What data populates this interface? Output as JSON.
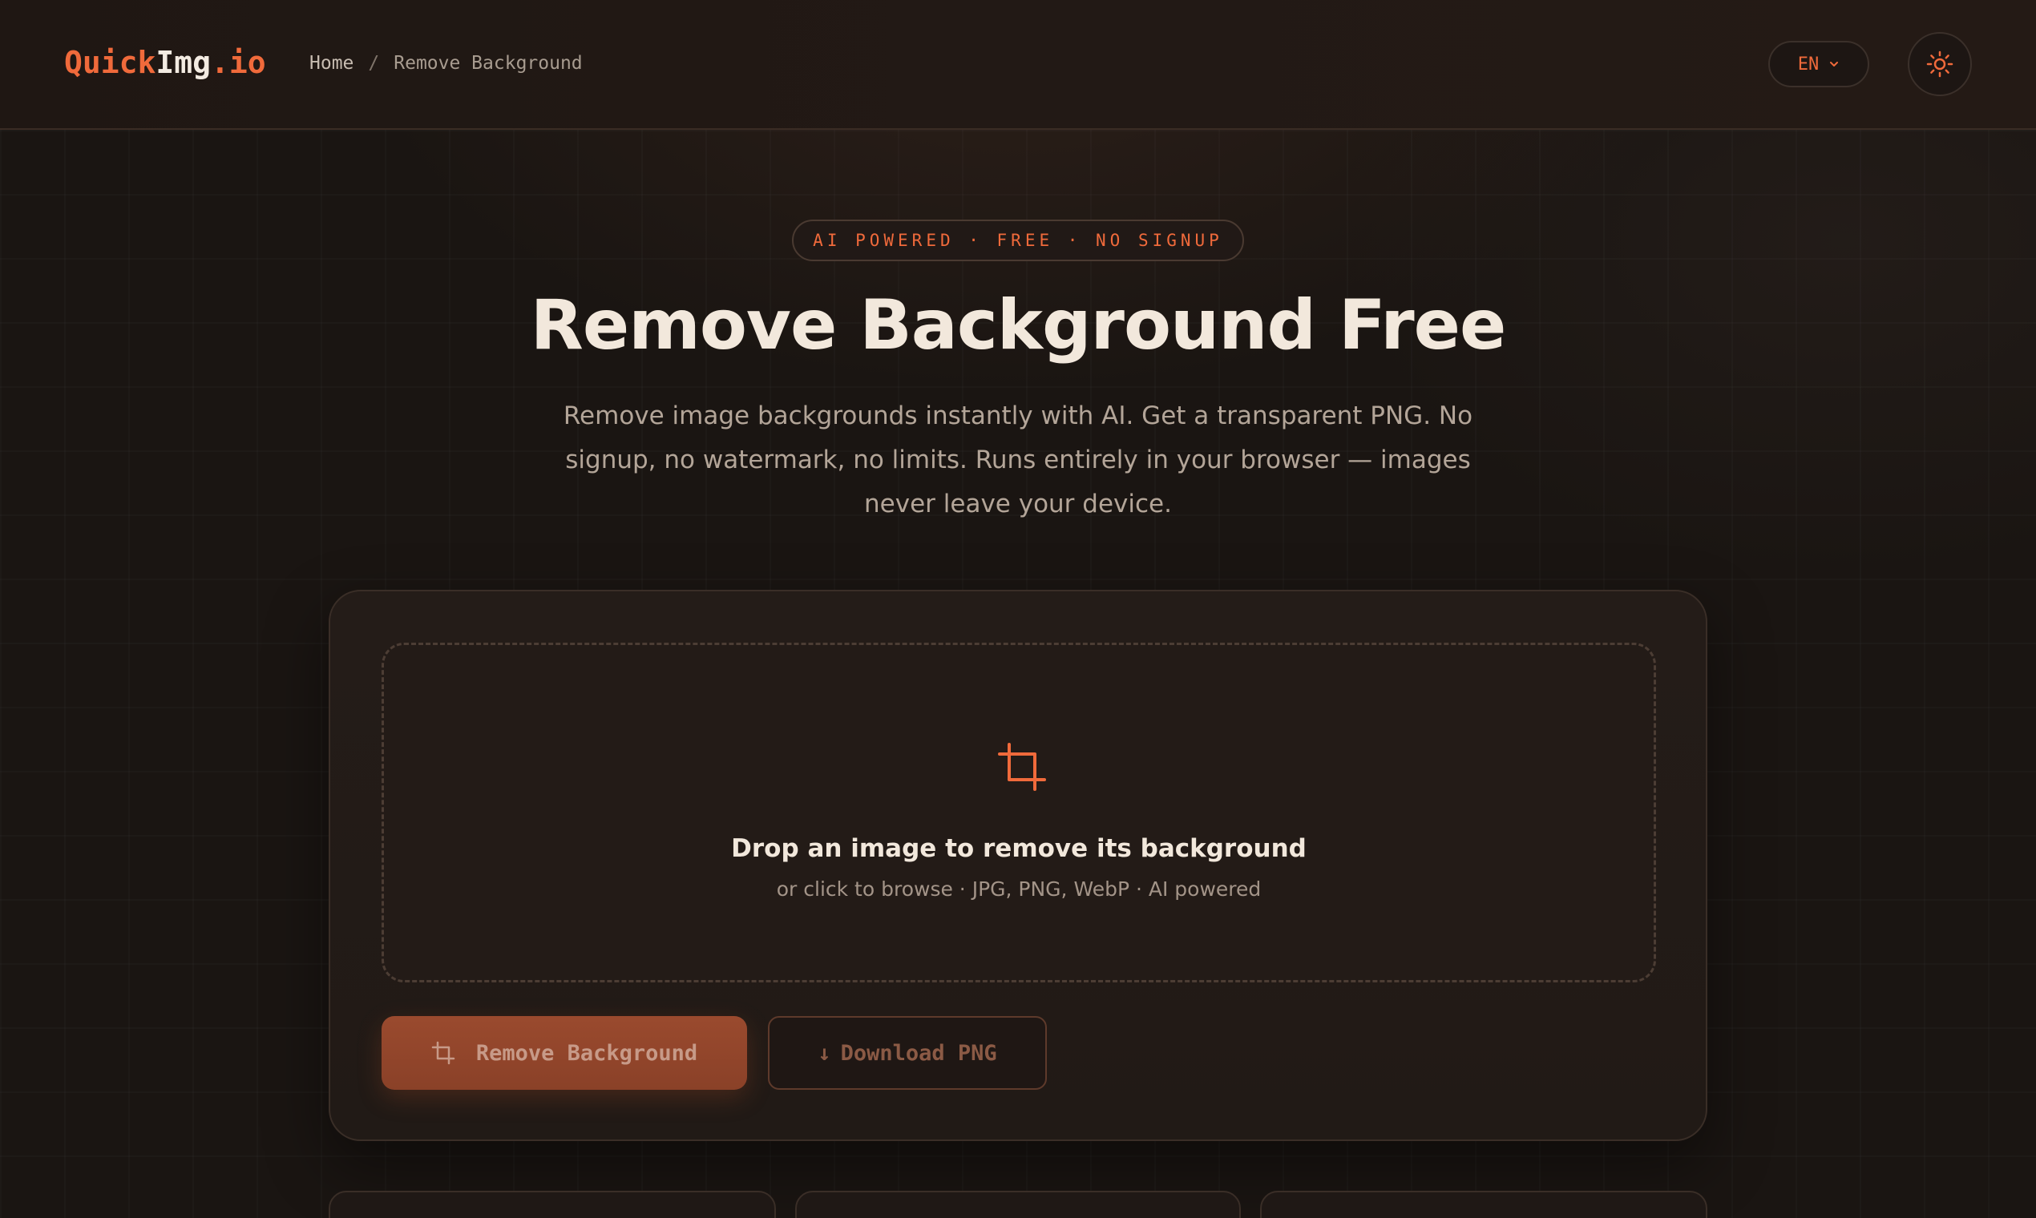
{
  "header": {
    "logo": {
      "part1": "Quick",
      "part2": "Img",
      "part3": ".io"
    },
    "breadcrumb": {
      "home": "Home",
      "separator": "/",
      "current": "Remove Background"
    },
    "language": "EN",
    "theme_toggle_icon": "sun-icon"
  },
  "hero": {
    "badge": "AI POWERED · FREE · NO SIGNUP",
    "title": "Remove Background Free",
    "subtitle": "Remove image backgrounds instantly with AI. Get a transparent PNG. No signup, no watermark, no limits. Runs entirely in your browser — images never leave your device."
  },
  "dropzone": {
    "icon": "crop-icon",
    "title": "Drop an image to remove its background",
    "subtitle": "or click to browse · JPG, PNG, WebP · AI powered"
  },
  "actions": {
    "remove_label": "Remove Background",
    "download_label": "Download PNG",
    "download_icon": "↓"
  },
  "colors": {
    "accent": "#f06a3b",
    "background": "#1a1512",
    "card": "#241c18",
    "text": "#f2e8dc",
    "muted": "#b3a598"
  }
}
